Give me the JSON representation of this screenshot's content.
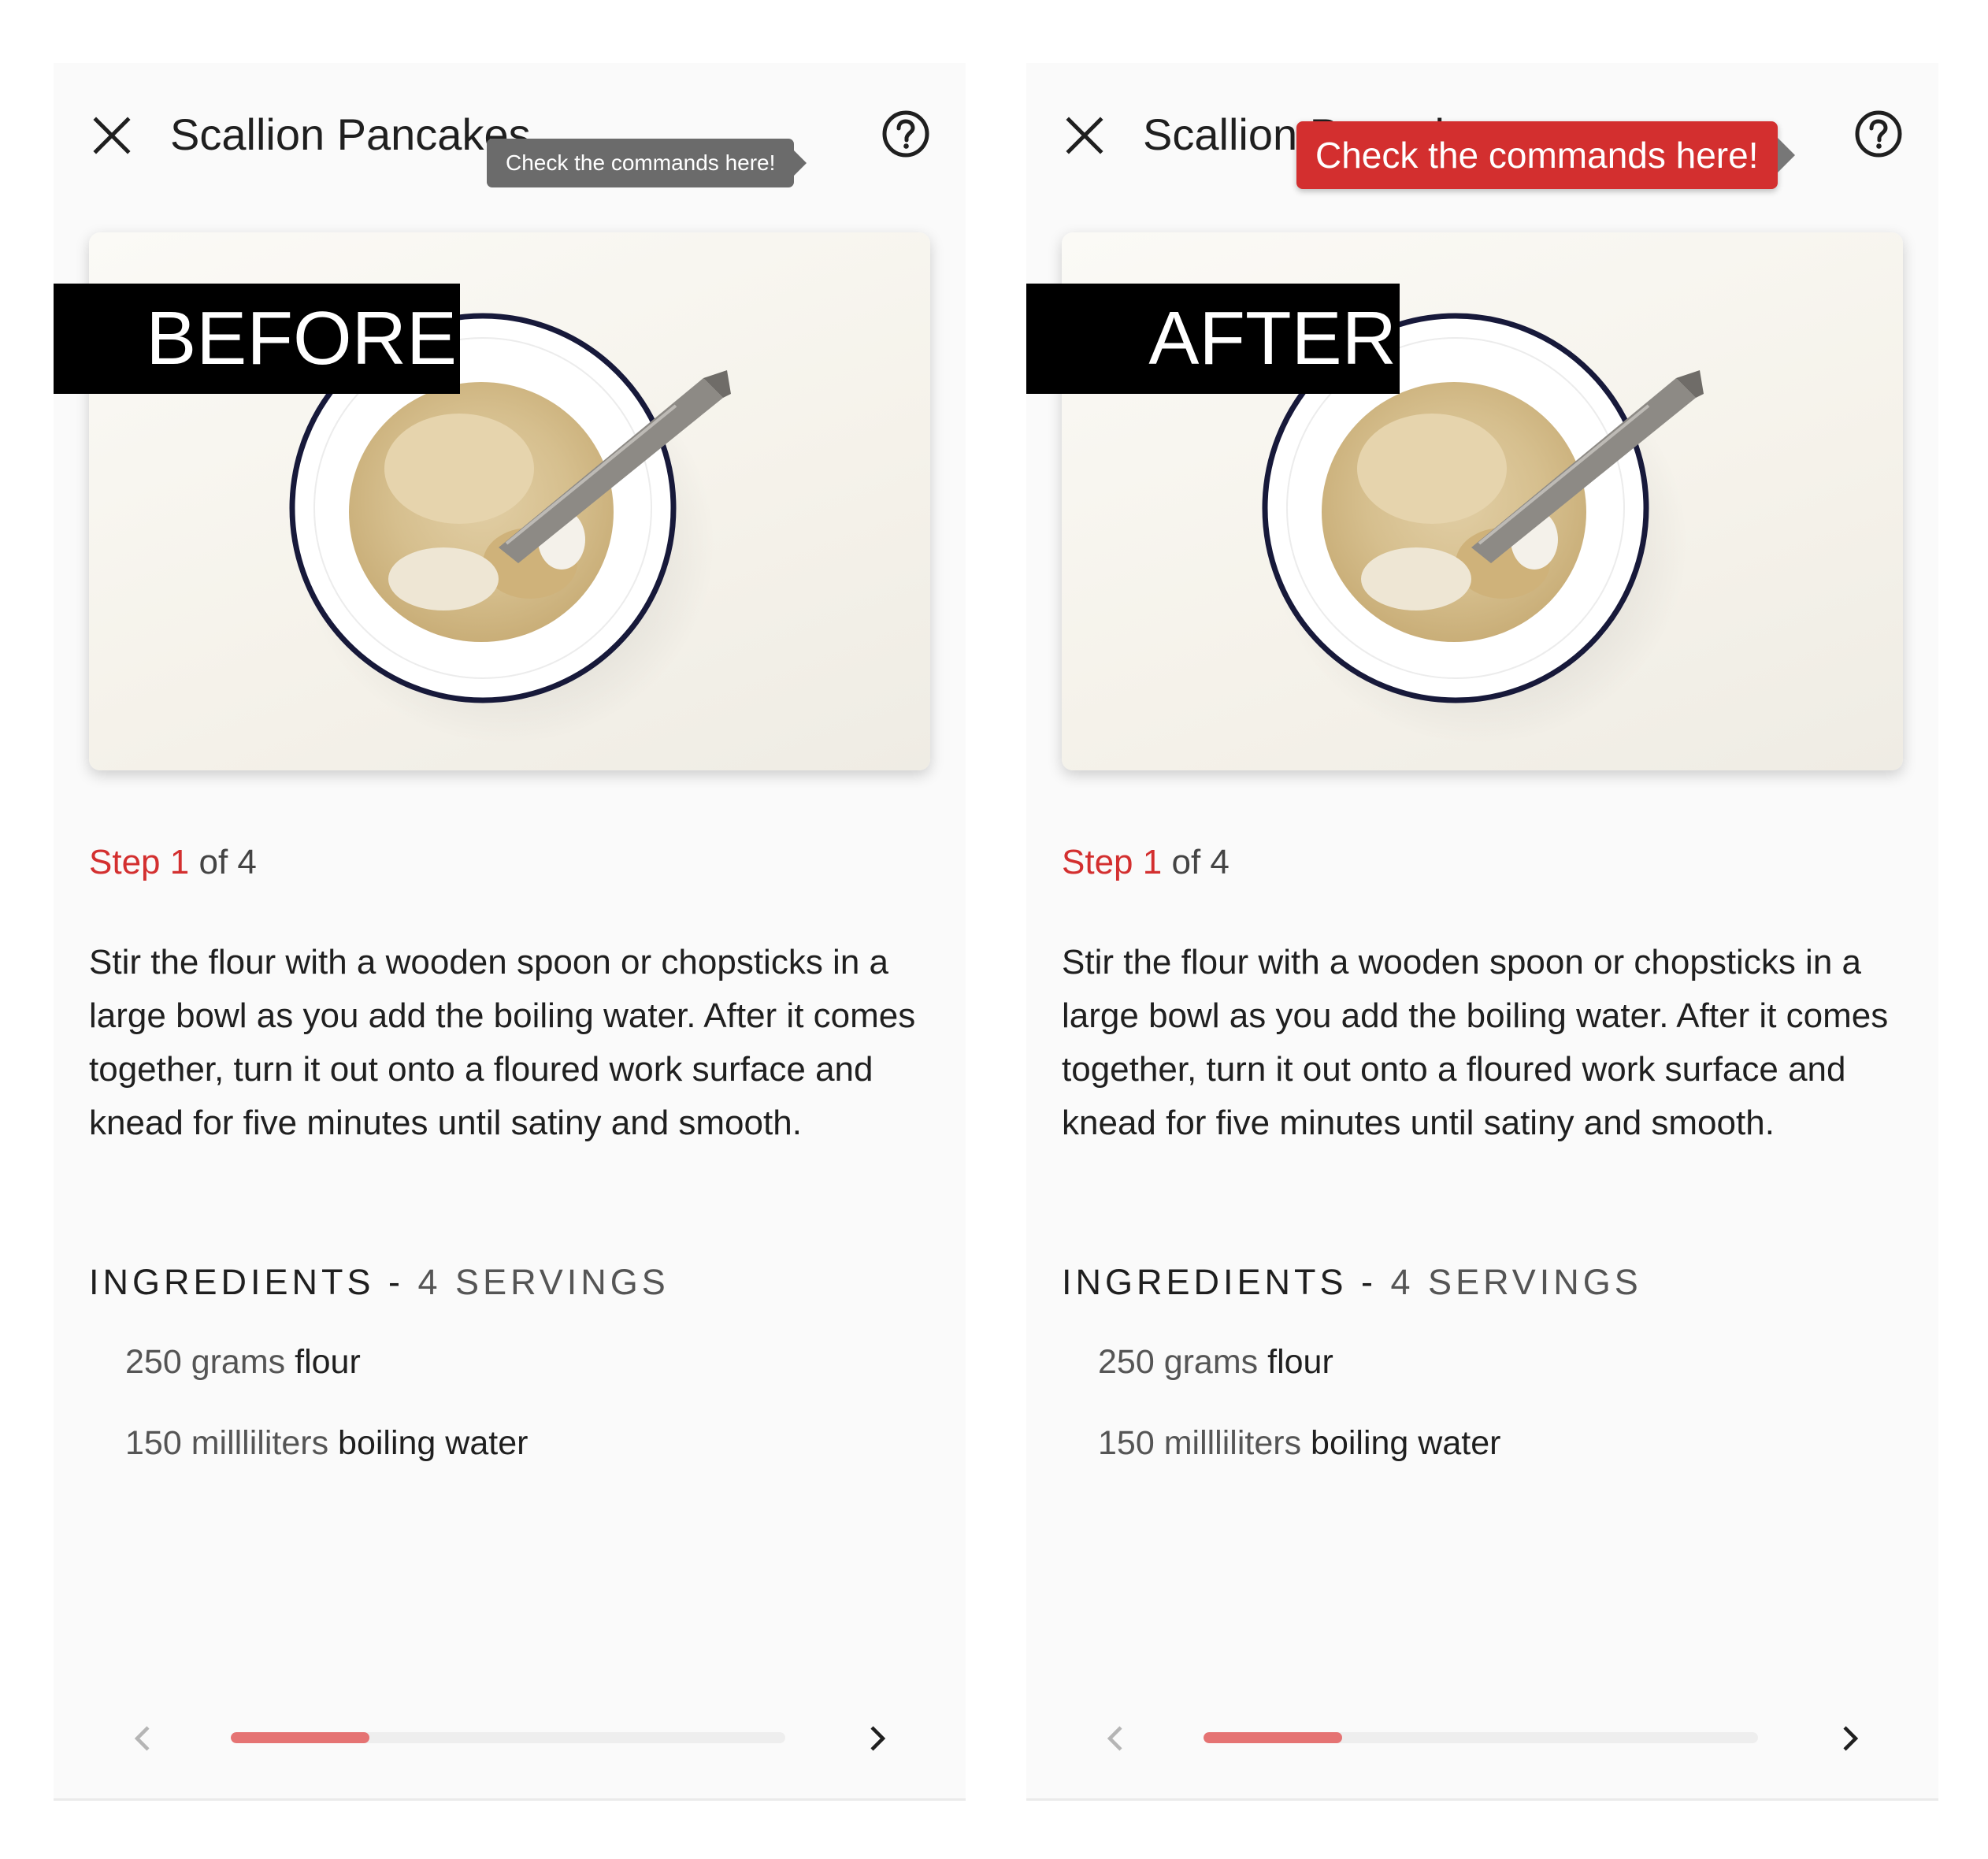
{
  "colors": {
    "accent": "#d32f2f",
    "progress_fill": "#e57373",
    "tooltip_small_bg": "#6b6b6b"
  },
  "panels": [
    {
      "label": "BEFORE",
      "title": "Scallion Pancakes",
      "tooltip": "Check the commands here!",
      "step": {
        "word": "Step",
        "current": "1",
        "of_text": "of 4"
      },
      "instruction": "Stir the flour with a wooden spoon or chopsticks in a large bowl as you add the boiling water. After it comes together, turn it out onto a floured work surface and knead for five minutes until satiny and smooth.",
      "ingredients_heading": "INGREDIENTS - ",
      "servings": "4 SERVINGS",
      "ingredients": [
        {
          "qty": "250 grams",
          "name": "flour"
        },
        {
          "qty": "150 millliliters",
          "name": "boiling water"
        }
      ],
      "progress": 0.25,
      "icons": {
        "close": "close-icon",
        "help": "help-circle-icon",
        "prev": "chevron-left-icon",
        "next": "chevron-right-icon"
      }
    },
    {
      "label": "AFTER",
      "title": "Scallion Pancakes",
      "tooltip": "Check the commands here!",
      "step": {
        "word": "Step",
        "current": "1",
        "of_text": "of 4"
      },
      "instruction": "Stir the flour with a wooden spoon or chopsticks in a large bowl as you add the boiling water. After it comes together, turn it out onto a floured work surface and knead for five minutes until satiny and smooth.",
      "ingredients_heading": "INGREDIENTS - ",
      "servings": "4 SERVINGS",
      "ingredients": [
        {
          "qty": "250 grams",
          "name": "flour"
        },
        {
          "qty": "150 millliliters",
          "name": "boiling water"
        }
      ],
      "progress": 0.25,
      "icons": {
        "close": "close-icon",
        "help": "help-circle-icon",
        "prev": "chevron-left-icon",
        "next": "chevron-right-icon"
      }
    }
  ]
}
